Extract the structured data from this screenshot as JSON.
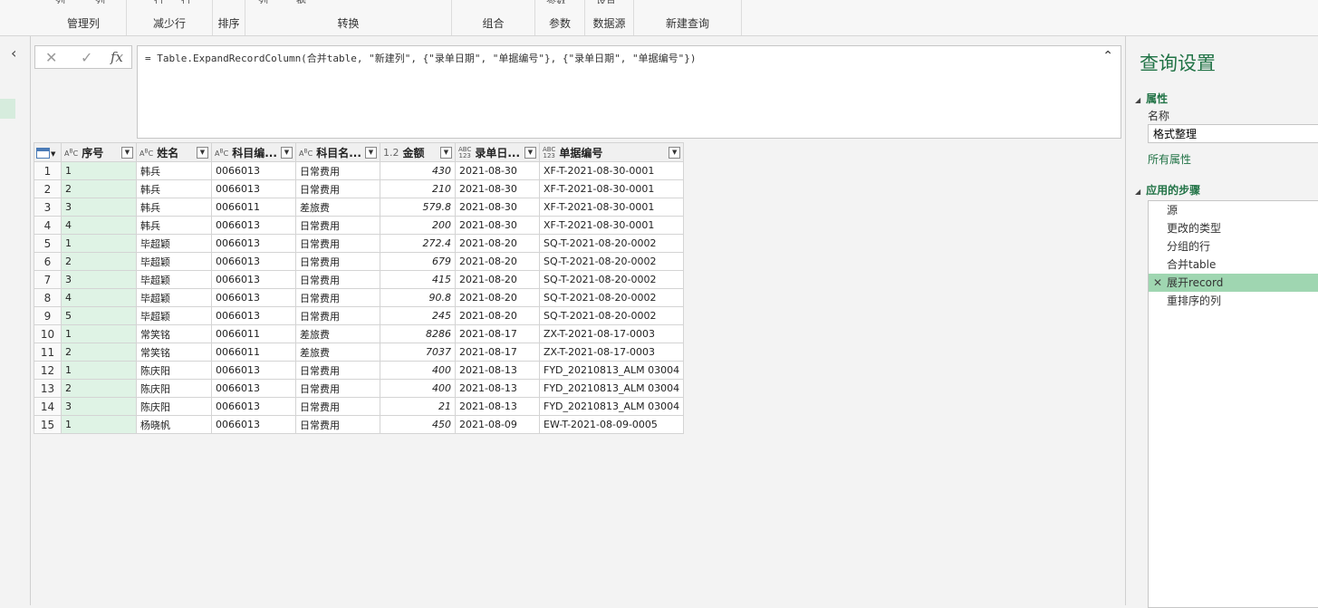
{
  "ribbon": {
    "groups": [
      {
        "label": "管理列",
        "cut": [
          "列",
          "列"
        ]
      },
      {
        "label": "减少行",
        "cut": [
          "行",
          "行"
        ]
      },
      {
        "label": "排序",
        "cut": []
      },
      {
        "label": "转换",
        "cut": [
          "列",
          "据"
        ]
      },
      {
        "label": "组合",
        "cut": []
      },
      {
        "label": "参数",
        "cut": [
          "参数"
        ]
      },
      {
        "label": "数据源",
        "cut": [
          "设置"
        ]
      },
      {
        "label": "新建查询",
        "cut": []
      }
    ]
  },
  "nav": {
    "collapse_icon": "‹"
  },
  "formula": {
    "cancel": "✕",
    "confirm": "✓",
    "fx": "fx",
    "text": "= Table.ExpandRecordColumn(合并table, \"新建列\", {\"录单日期\", \"单据编号\"}, {\"录单日期\", \"单据编号\"})",
    "expand_icon": "⌃"
  },
  "table": {
    "columns": [
      {
        "type": "ABC",
        "name": "序号"
      },
      {
        "type": "ABC",
        "name": "姓名"
      },
      {
        "type": "ABC",
        "name": "科目编..."
      },
      {
        "type": "ABC",
        "name": "科目名..."
      },
      {
        "type": "1.2",
        "name": "金额"
      },
      {
        "type": "ABC123",
        "name": "录单日..."
      },
      {
        "type": "ABC123",
        "name": "单据编号"
      }
    ],
    "rows": [
      [
        "1",
        "1",
        "韩兵",
        "0066013",
        "日常费用",
        "430",
        "2021-08-30",
        "XF-T-2021-08-30-0001"
      ],
      [
        "2",
        "2",
        "韩兵",
        "0066013",
        "日常费用",
        "210",
        "2021-08-30",
        "XF-T-2021-08-30-0001"
      ],
      [
        "3",
        "3",
        "韩兵",
        "0066011",
        "差旅费",
        "579.8",
        "2021-08-30",
        "XF-T-2021-08-30-0001"
      ],
      [
        "4",
        "4",
        "韩兵",
        "0066013",
        "日常费用",
        "200",
        "2021-08-30",
        "XF-T-2021-08-30-0001"
      ],
      [
        "5",
        "1",
        "毕超颖",
        "0066013",
        "日常费用",
        "272.4",
        "2021-08-20",
        "SQ-T-2021-08-20-0002"
      ],
      [
        "6",
        "2",
        "毕超颖",
        "0066013",
        "日常费用",
        "679",
        "2021-08-20",
        "SQ-T-2021-08-20-0002"
      ],
      [
        "7",
        "3",
        "毕超颖",
        "0066013",
        "日常费用",
        "415",
        "2021-08-20",
        "SQ-T-2021-08-20-0002"
      ],
      [
        "8",
        "4",
        "毕超颖",
        "0066013",
        "日常费用",
        "90.8",
        "2021-08-20",
        "SQ-T-2021-08-20-0002"
      ],
      [
        "9",
        "5",
        "毕超颖",
        "0066013",
        "日常费用",
        "245",
        "2021-08-20",
        "SQ-T-2021-08-20-0002"
      ],
      [
        "10",
        "1",
        "常笑铭",
        "0066011",
        "差旅费",
        "8286",
        "2021-08-17",
        "ZX-T-2021-08-17-0003"
      ],
      [
        "11",
        "2",
        "常笑铭",
        "0066011",
        "差旅费",
        "7037",
        "2021-08-17",
        "ZX-T-2021-08-17-0003"
      ],
      [
        "12",
        "1",
        "陈庆阳",
        "0066013",
        "日常费用",
        "400",
        "2021-08-13",
        "FYD_20210813_ALM 03004"
      ],
      [
        "13",
        "2",
        "陈庆阳",
        "0066013",
        "日常费用",
        "400",
        "2021-08-13",
        "FYD_20210813_ALM 03004"
      ],
      [
        "14",
        "3",
        "陈庆阳",
        "0066013",
        "日常费用",
        "21",
        "2021-08-13",
        "FYD_20210813_ALM 03004"
      ],
      [
        "15",
        "1",
        "杨晓帆",
        "0066013",
        "日常费用",
        "450",
        "2021-08-09",
        "EW-T-2021-08-09-0005"
      ]
    ]
  },
  "query_settings": {
    "title": "查询设置",
    "properties_header": "属性",
    "name_label": "名称",
    "name_value": "格式整理",
    "all_properties": "所有属性",
    "steps_header": "应用的步骤",
    "steps": [
      "源",
      "更改的类型",
      "分组的行",
      "合并table",
      "展开record",
      "重排序的列"
    ],
    "active_step": 4
  }
}
